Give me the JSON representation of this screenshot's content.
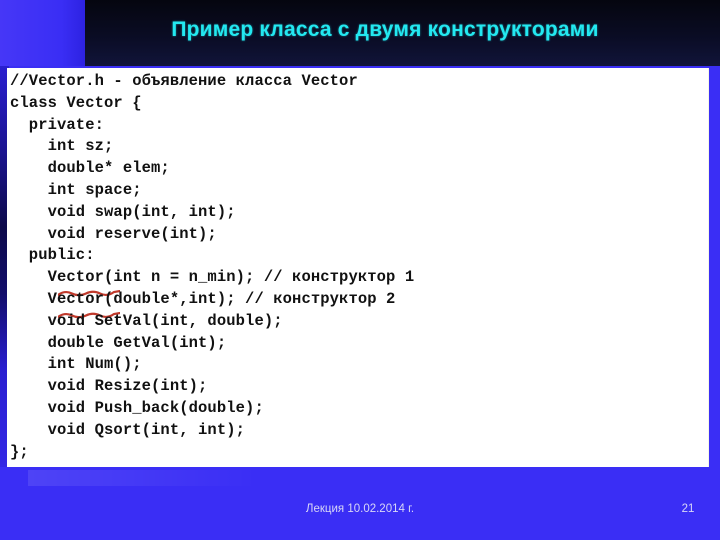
{
  "slide": {
    "title": "Пример класса с двумя конструкторами",
    "accent_cyan": "#23e8f0",
    "accent_blue": "#3a2ef5",
    "header_navy": "#0a0c24",
    "squiggle_red": "#c0392b"
  },
  "code": {
    "language": "cpp",
    "lines": [
      {
        "text": "//Vector.h - объявление класса Vector",
        "squiggle": false
      },
      {
        "text": "class Vector {",
        "squiggle": false
      },
      {
        "text": "  private:",
        "squiggle": false
      },
      {
        "text": "    int sz;",
        "squiggle": false
      },
      {
        "text": "    double* elem;",
        "squiggle": false
      },
      {
        "text": "    int space;",
        "squiggle": false
      },
      {
        "text": "    void swap(int, int);",
        "squiggle": false
      },
      {
        "text": "    void reserve(int);",
        "squiggle": false
      },
      {
        "text": "  public:",
        "squiggle": false
      },
      {
        "text": "    Vector(int n = n_min); // конструктор 1",
        "squiggle": true
      },
      {
        "text": "    Vector(double*,int); // конструктор 2",
        "squiggle": true
      },
      {
        "text": "    void SetVal(int, double);",
        "squiggle": false
      },
      {
        "text": "    double GetVal(int);",
        "squiggle": false
      },
      {
        "text": "    int Num();",
        "squiggle": false
      },
      {
        "text": "    void Resize(int);",
        "squiggle": false
      },
      {
        "text": "    void Push_back(double);",
        "squiggle": false
      },
      {
        "text": "    void Qsort(int, int);",
        "squiggle": false
      },
      {
        "text": "};",
        "squiggle": false
      }
    ]
  },
  "footer": {
    "date_label": "Лекция 10.02.2014 г.",
    "page_number": "21"
  }
}
